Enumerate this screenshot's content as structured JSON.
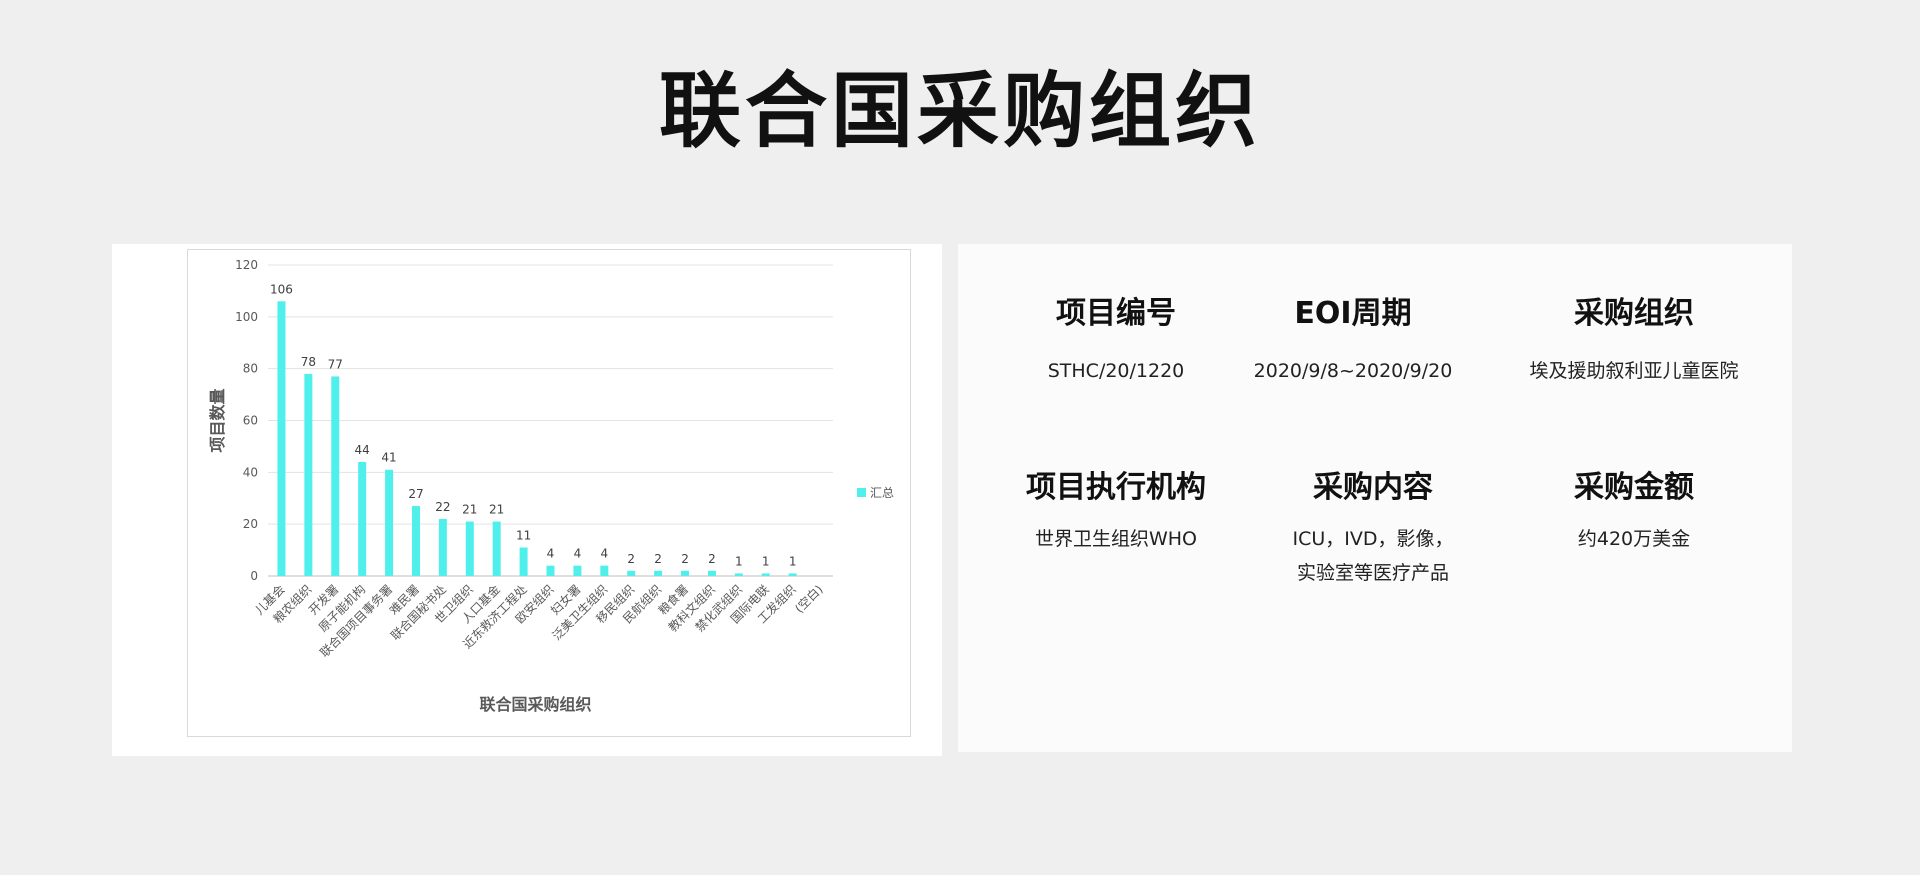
{
  "page": {
    "title": "联合国采购组织"
  },
  "chart_data": {
    "type": "bar",
    "xlabel": "联合国采购组织",
    "ylabel": "项目数量",
    "ylim": [
      0,
      120
    ],
    "yticks": [
      0,
      20,
      40,
      60,
      80,
      100,
      120
    ],
    "grid": true,
    "legend": "right",
    "color": "#4ff0ec",
    "categories": [
      "儿基会",
      "粮农组织",
      "开发署",
      "原子能机构",
      "联合国项目事务署",
      "难民署",
      "联合国秘书处",
      "世卫组织",
      "人口基金",
      "近东救济工程处",
      "欧安组织",
      "妇女署",
      "泛美卫生组织",
      "移民组织",
      "民航组织",
      "粮食署",
      "教科文组织",
      "禁化武组织",
      "国际电联",
      "工发组织",
      "(空白)"
    ],
    "series": [
      {
        "name": "汇总",
        "values": [
          106,
          78,
          77,
          44,
          41,
          27,
          22,
          21,
          21,
          11,
          4,
          4,
          4,
          2,
          2,
          2,
          2,
          1,
          1,
          1,
          0
        ]
      }
    ]
  },
  "info": {
    "project_no": {
      "label": "项目编号",
      "value": "STHC/20/1220"
    },
    "eoi_period": {
      "label": "EOI周期",
      "value": "2020/9/8~2020/9/20"
    },
    "purchaser": {
      "label": "采购组织",
      "value": "埃及援助叙利亚儿童医院"
    },
    "executing_agency": {
      "label": "项目执行机构",
      "value": "世界卫生组织WHO"
    },
    "content": {
      "label": "采购内容",
      "value_line1": "ICU，IVD，影像，",
      "value_line2": "实验室等医疗产品"
    },
    "amount": {
      "label": "采购金额",
      "value": "约420万美金"
    }
  }
}
